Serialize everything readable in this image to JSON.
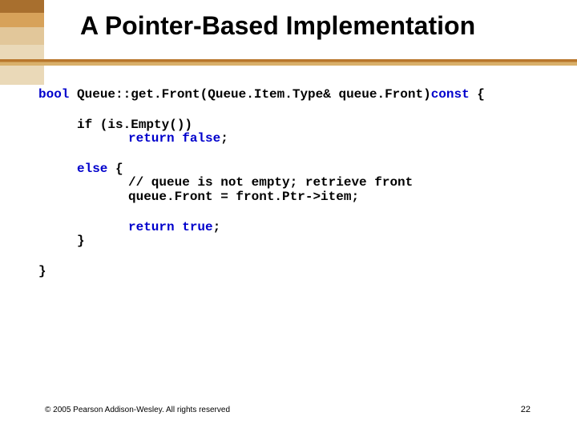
{
  "title": "A Pointer-Based Implementation",
  "code": {
    "kw_bool": "bool",
    "sig_mid": " Queue::get.Front(Queue.Item.Type& queue.Front)",
    "kw_const": "const",
    "sig_end": " {",
    "if_line": "if (is.Empty())",
    "kw_return1": "return",
    "kw_false": " false",
    "semi1": ";",
    "kw_else": "else",
    "else_open": " {",
    "comment": "// queue is not empty; retrieve front",
    "assign": "queue.Front = front.Ptr->item;",
    "kw_return2": "return",
    "kw_true": " true",
    "semi2": ";",
    "brace_inner": "}",
    "brace_outer": "}"
  },
  "footer": {
    "copyright": "© 2005 Pearson Addison-Wesley. All rights reserved",
    "page": "22"
  }
}
